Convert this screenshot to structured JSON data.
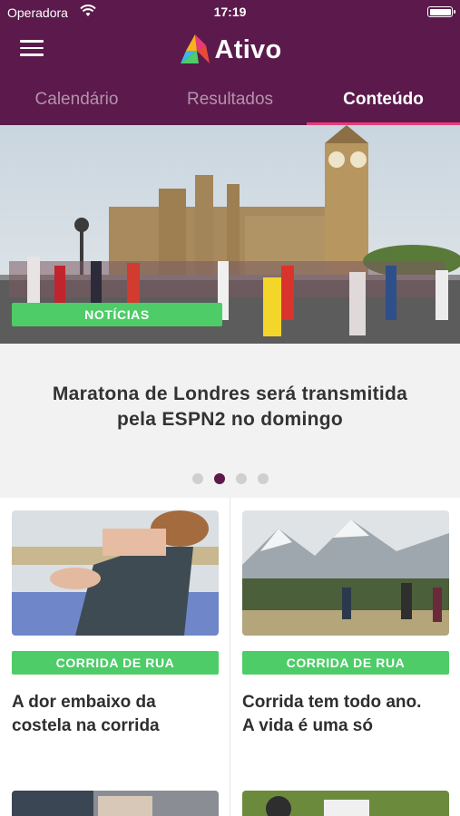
{
  "status_bar": {
    "carrier": "Operadora",
    "time": "17:19"
  },
  "app": {
    "name": "Ativo"
  },
  "tabs": [
    {
      "label": "Calendário",
      "active": false
    },
    {
      "label": "Resultados",
      "active": false
    },
    {
      "label": "Conteúdo",
      "active": true
    }
  ],
  "featured": {
    "category": "NOTÍCIAS",
    "title_line1": "Maratona de Londres será transmitida",
    "title_line2": "pela ESPN2 no domingo",
    "page_index": 2,
    "page_count": 4
  },
  "articles": [
    {
      "category": "CORRIDA DE RUA",
      "title_line1": "A dor embaixo da",
      "title_line2": "costela na corrida"
    },
    {
      "category": "CORRIDA DE RUA",
      "title_line1": "Corrida tem todo ano.",
      "title_line2": "A vida é uma só"
    }
  ],
  "colors": {
    "brand": "#5b1a4b",
    "accent": "#e83a7b",
    "badge": "#4dcc68"
  }
}
